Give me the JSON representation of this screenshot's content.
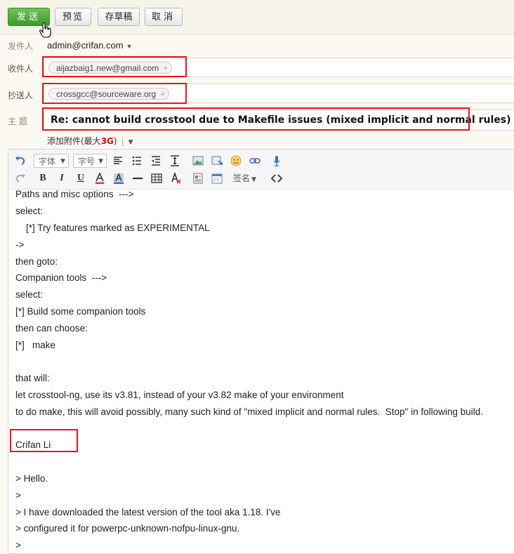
{
  "toolbar": {
    "send_label": "发送",
    "preview_label": "预览",
    "draft_label": "存草稿",
    "cancel_label": "取消"
  },
  "from": {
    "label": "发件人",
    "value": "admin@crifan.com"
  },
  "to": {
    "label": "收件人",
    "recipient": "aijazbaig1.new@gmail.com"
  },
  "cc": {
    "label": "抄送人",
    "recipient": "crossgcc@sourceware.org"
  },
  "subject": {
    "label": "主  题",
    "value": "Re: cannot build crosstool due to Makefile issues (mixed implicit and normal rules)"
  },
  "attach": {
    "prefix": "添加附件(最大",
    "size": "3G",
    "suffix": ")"
  },
  "editor": {
    "font_label": "字体",
    "size_label": "字号",
    "signature_label": "签名"
  },
  "body_lines": [
    "Paths and misc options  --->",
    "select:",
    "    [*] Try features marked as EXPERIMENTAL",
    "->",
    "then goto:",
    "Companion tools  --->",
    "select:",
    "[*] Build some companion tools",
    "then can choose:",
    "[*]   make",
    "",
    "that will:",
    "let crosstool-ng, use its v3.81, instead of your v3.82 make of your environment",
    "to do make, this will avoid possibly, many such kind of \"mixed implicit and normal rules.  Stop\" in following build.",
    "",
    "Crifan Li",
    "",
    "> Hello.",
    ">",
    "> I have downloaded the latest version of the tool aka 1.18. I've",
    "> configured it for powerpc-unknown-nofpu-linux-gnu.",
    ">"
  ],
  "colors": {
    "accent_green": "#4caf34",
    "highlight_red": "#e8141e"
  }
}
